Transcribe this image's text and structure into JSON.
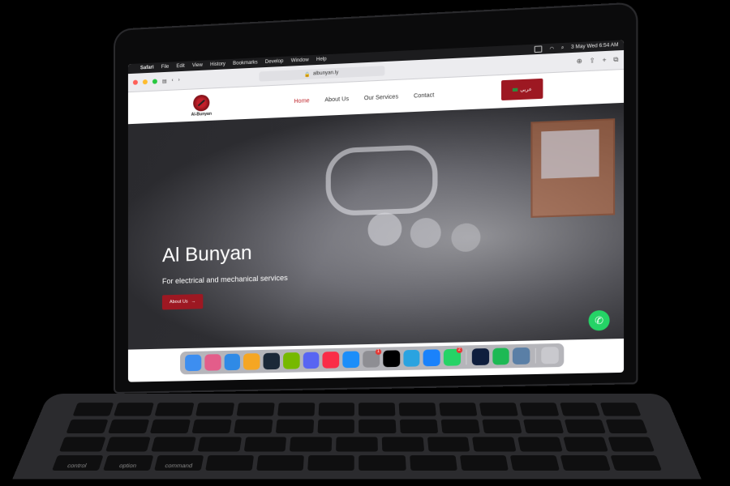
{
  "menubar": {
    "apple_glyph": "",
    "app_name": "Safari",
    "menus": [
      "File",
      "Edit",
      "View",
      "History",
      "Bookmarks",
      "Develop",
      "Window",
      "Help"
    ],
    "datetime": "3 May Wed  6:54 AM"
  },
  "browser": {
    "url": "albunyan.ly",
    "lock_icon": "lock-icon",
    "traffic_lights": [
      "#ff5f57",
      "#febc2e",
      "#28c840"
    ]
  },
  "site": {
    "logo_text": "Al-Bunyan",
    "nav": {
      "home": "Home",
      "about": "About Us",
      "services": "Our Services",
      "contact": "Contact"
    },
    "language_button": "عربي",
    "hero": {
      "title": "Al Bunyan",
      "subtitle": "For electrical and mechanical services",
      "button": "About Us"
    },
    "accent_color": "#9d1822"
  },
  "dock": {
    "apps": [
      {
        "name": "finder-icon",
        "color": "#3d8ef0"
      },
      {
        "name": "launchpad-icon",
        "color": "#e35d8a"
      },
      {
        "name": "mail-icon",
        "color": "#2f8ae6"
      },
      {
        "name": "photos-icon",
        "color": "#f5a623"
      },
      {
        "name": "steam-icon",
        "color": "#1b2838"
      },
      {
        "name": "nvidia-icon",
        "color": "#76b900"
      },
      {
        "name": "discord-icon",
        "color": "#5865f2"
      },
      {
        "name": "music-icon",
        "color": "#fa2d48"
      },
      {
        "name": "appstore-icon",
        "color": "#1c8ef9"
      },
      {
        "name": "settings-icon",
        "color": "#8e8e93",
        "badge": "1"
      },
      {
        "name": "intellij-icon",
        "color": "#000000"
      },
      {
        "name": "telegram-icon",
        "color": "#2aa3e0"
      },
      {
        "name": "safari-icon",
        "color": "#1a82fb"
      },
      {
        "name": "whatsapp-icon",
        "color": "#25d366",
        "badge": "2"
      },
      {
        "name": "photoshop-icon",
        "color": "#0f1e3d"
      },
      {
        "name": "spotify-icon",
        "color": "#1db954"
      },
      {
        "name": "preview-icon",
        "color": "#5a7fa6"
      },
      {
        "name": "trash-icon",
        "color": "#c9c9ce"
      }
    ]
  },
  "keyboard": {
    "visible_key_labels": [
      "control",
      "option",
      "command"
    ]
  }
}
